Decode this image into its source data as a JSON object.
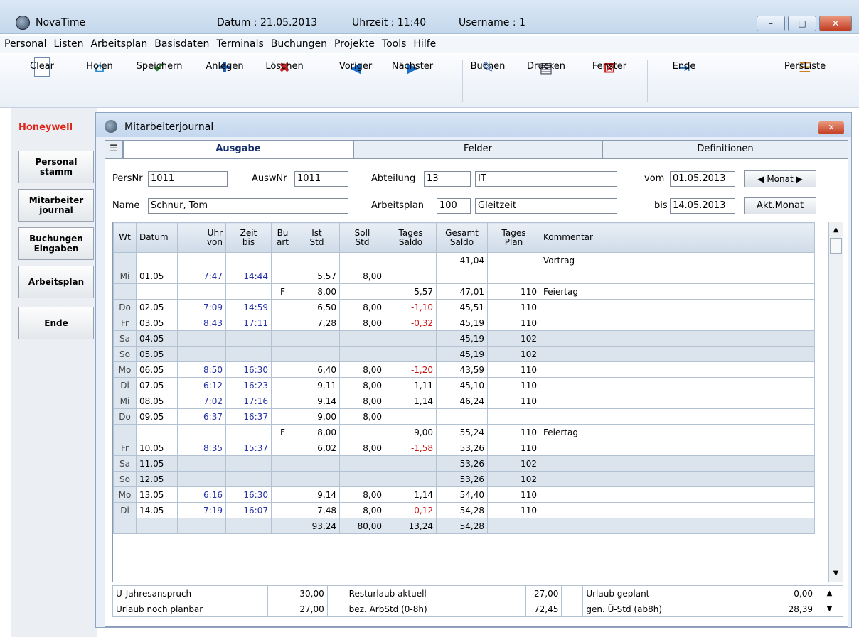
{
  "window": {
    "app_name": "NovaTime",
    "datum": "Datum : 21.05.2013",
    "uhrzeit": "Uhrzeit : 11:40",
    "username": "Username : 1"
  },
  "menu": [
    "Personal",
    "Listen",
    "Arbeitsplan",
    "Basisdaten",
    "Terminals",
    "Buchungen",
    "Projekte",
    "Tools",
    "Hilfe"
  ],
  "toolbar": {
    "clear": "Clear",
    "holen": "Holen",
    "speichern": "Speichern",
    "anlegen": "Anlegen",
    "loeschen": "Löschen",
    "voriger": "Voriger",
    "naechster": "Nächster",
    "buchen": "Buchen",
    "drucken": "Drucken",
    "fenster": "Fenster",
    "ende": "Ende",
    "persliste": "PersListe"
  },
  "sidebar": {
    "brand": "Honeywell",
    "items": [
      "Personal\nstamm",
      "Mitarbeiter\njournal",
      "Buchungen\nEingaben",
      "Arbeitsplan",
      "Ende"
    ]
  },
  "journal": {
    "title": "Mitarbeiterjournal",
    "tabs": [
      "Ausgabe",
      "Felder",
      "Definitionen"
    ],
    "form": {
      "persnr_label": "PersNr",
      "persnr": "1011",
      "auswnr_label": "AuswNr",
      "auswnr": "1011",
      "abteilung_label": "Abteilung",
      "abteilung_nr": "13",
      "abteilung_name": "IT",
      "vom_label": "vom",
      "vom": "01.05.2013",
      "monat_label": "Monat",
      "name_label": "Name",
      "name": "Schnur, Tom",
      "arbeitsplan_label": "Arbeitsplan",
      "arbeitsplan_nr": "100",
      "arbeitsplan_name": "Gleitzeit",
      "bis_label": "bis",
      "bis": "14.05.2013",
      "akt_monat": "Akt.Monat"
    },
    "columns": [
      "Wt",
      "Datum",
      "Uhr\nvon",
      "Zeit\nbis",
      "Bu\nart",
      "Ist\nStd",
      "Soll\nStd",
      "Tages\nSaldo",
      "Gesamt\nSaldo",
      "Tages\nPlan",
      "Kommentar"
    ],
    "rows": [
      [
        "",
        "",
        "",
        "",
        "",
        "",
        "",
        "",
        "41,04",
        "",
        "Vortrag"
      ],
      [
        "Mi",
        "01.05",
        "7:47",
        "14:44",
        "",
        "5,57",
        "8,00",
        "",
        "",
        "",
        ""
      ],
      [
        "",
        "",
        "",
        "",
        "F",
        "8,00",
        "",
        "5,57",
        "47,01",
        "110",
        "Feiertag"
      ],
      [
        "Do",
        "02.05",
        "7:09",
        "14:59",
        "",
        "6,50",
        "8,00",
        "-1,10",
        "45,51",
        "110",
        ""
      ],
      [
        "Fr",
        "03.05",
        "8:43",
        "17:11",
        "",
        "7,28",
        "8,00",
        "-0,32",
        "45,19",
        "110",
        ""
      ],
      [
        "Sa",
        "04.05",
        "",
        "",
        "",
        "",
        "",
        "",
        "45,19",
        "102",
        ""
      ],
      [
        "So",
        "05.05",
        "",
        "",
        "",
        "",
        "",
        "",
        "45,19",
        "102",
        ""
      ],
      [
        "Mo",
        "06.05",
        "8:50",
        "16:30",
        "",
        "6,40",
        "8,00",
        "-1,20",
        "43,59",
        "110",
        ""
      ],
      [
        "Di",
        "07.05",
        "6:12",
        "16:23",
        "",
        "9,11",
        "8,00",
        "1,11",
        "45,10",
        "110",
        ""
      ],
      [
        "Mi",
        "08.05",
        "7:02",
        "17:16",
        "",
        "9,14",
        "8,00",
        "1,14",
        "46,24",
        "110",
        ""
      ],
      [
        "Do",
        "09.05",
        "6:37",
        "16:37",
        "",
        "9,00",
        "8,00",
        "",
        "",
        "",
        ""
      ],
      [
        "",
        "",
        "",
        "",
        "F",
        "8,00",
        "",
        "9,00",
        "55,24",
        "110",
        "Feiertag"
      ],
      [
        "Fr",
        "10.05",
        "8:35",
        "15:37",
        "",
        "6,02",
        "8,00",
        "-1,58",
        "53,26",
        "110",
        ""
      ],
      [
        "Sa",
        "11.05",
        "",
        "",
        "",
        "",
        "",
        "",
        "53,26",
        "102",
        ""
      ],
      [
        "So",
        "12.05",
        "",
        "",
        "",
        "",
        "",
        "",
        "53,26",
        "102",
        ""
      ],
      [
        "Mo",
        "13.05",
        "6:16",
        "16:30",
        "",
        "9,14",
        "8,00",
        "1,14",
        "54,40",
        "110",
        ""
      ],
      [
        "Di",
        "14.05",
        "7:19",
        "16:07",
        "",
        "7,48",
        "8,00",
        "-0,12",
        "54,28",
        "110",
        ""
      ],
      [
        "",
        "",
        "",
        "",
        "",
        "93,24",
        "80,00",
        "13,24",
        "54,28",
        "",
        ""
      ]
    ],
    "summary": [
      [
        "U-Jahresanspruch",
        "30,00",
        "Resturlaub aktuell",
        "27,00",
        "Urlaub geplant",
        "0,00"
      ],
      [
        "Urlaub noch planbar",
        "27,00",
        "bez. ArbStd (0-8h)",
        "72,45",
        "gen. Ü-Std (ab8h)",
        "28,39"
      ]
    ]
  },
  "colors": {
    "accent": "#2230a8",
    "negative": "#cc1111",
    "brand": "#e1251b"
  }
}
